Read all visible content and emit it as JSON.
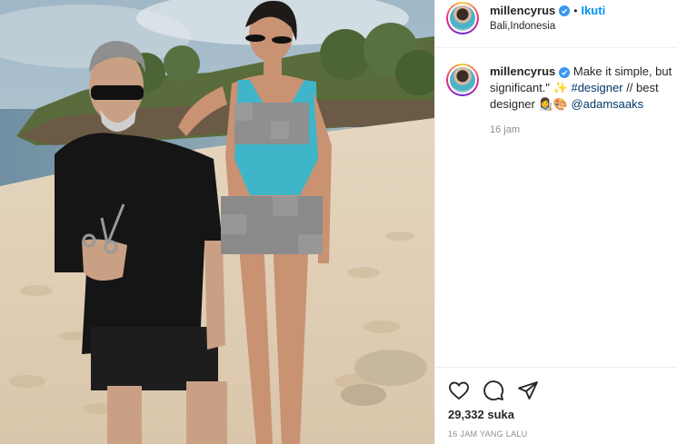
{
  "post": {
    "username": "millencyrus",
    "follow_label": "Ikuti",
    "separator": "•",
    "location": "Bali,Indonesia"
  },
  "caption": {
    "username": "millencyrus",
    "text_before": " Make it simple, but significant.\" ✨",
    "hashtag": "#designer",
    "text_middle": " // best designer 👩‍🎨🎨 ",
    "mention": "@adamsaaks",
    "time": "16 jam"
  },
  "stats": {
    "likes": "29,332 suka",
    "posted": "16 JAM YANG LALU"
  },
  "icons": {
    "like": "heart-icon",
    "comment": "comment-icon",
    "share": "share-icon",
    "verified": "verified-badge-icon"
  },
  "colors": {
    "link": "#0095f6",
    "verified": "#3897f0",
    "hashtag": "#00376b",
    "muted": "#8e8e8e"
  }
}
